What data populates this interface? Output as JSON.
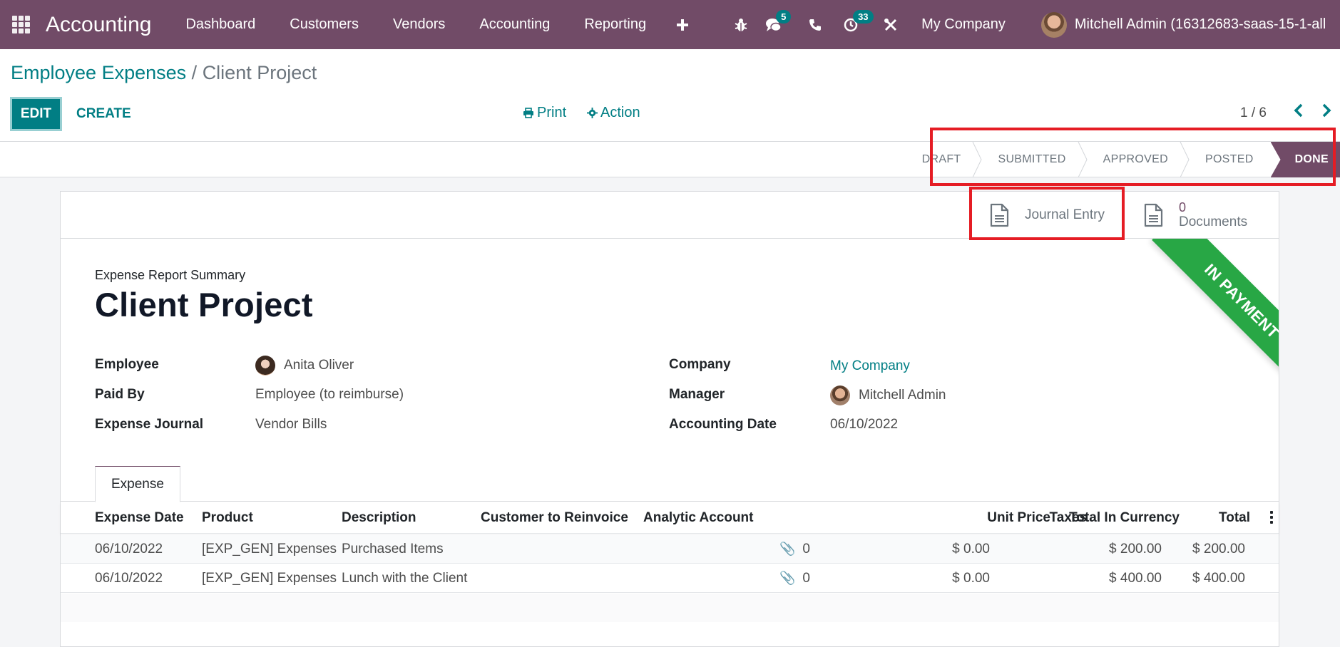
{
  "navbar": {
    "app_name": "Accounting",
    "menu": [
      "Dashboard",
      "Customers",
      "Vendors",
      "Accounting",
      "Reporting"
    ],
    "icons": {
      "apps": "apps-grid-icon",
      "plus": "plus-icon",
      "debug": "bug-icon",
      "messages": "chat-icon",
      "phone": "phone-icon",
      "activities": "clock-icon",
      "tools": "tools-icon"
    },
    "messages_badge": "5",
    "activities_badge": "33",
    "company": "My Company",
    "user": "Mitchell Admin (16312683-saas-15-1-all"
  },
  "control": {
    "breadcrumb_parent": "Employee Expenses",
    "breadcrumb_sep": "/",
    "breadcrumb_current": "Client Project",
    "edit_label": "EDIT",
    "create_label": "CREATE",
    "print_label": "Print",
    "action_label": "Action",
    "pager": "1 / 6",
    "pager_prev": "‹",
    "pager_next": "›"
  },
  "status": {
    "steps": [
      "DRAFT",
      "SUBMITTED",
      "APPROVED",
      "POSTED",
      "DONE"
    ],
    "active": "DONE"
  },
  "smart_buttons": {
    "journal_entry": "Journal Entry",
    "documents_count": "0",
    "documents_label": "Documents"
  },
  "ribbon": "IN PAYMENT",
  "form": {
    "subtitle": "Expense Report Summary",
    "title": "Client Project",
    "left_fields": [
      {
        "label": "Employee",
        "value": "Anita Oliver"
      },
      {
        "label": "Paid By",
        "value": "Employee (to reimburse)"
      },
      {
        "label": "Expense Journal",
        "value": "Vendor Bills"
      }
    ],
    "right_fields": [
      {
        "label": "Company",
        "value": "My Company"
      },
      {
        "label": "Manager",
        "value": "Mitchell Admin"
      },
      {
        "label": "Accounting Date",
        "value": "06/10/2022"
      }
    ]
  },
  "tabs": [
    "Expense"
  ],
  "table": {
    "columns": [
      "Expense Date",
      "Product",
      "Description",
      "Customer to Reinvoice",
      "Analytic Account",
      "Unit Price",
      "Taxes",
      "Total In Currency",
      "Total"
    ],
    "rows": [
      {
        "date": "06/10/2022",
        "product": "[EXP_GEN] Expenses",
        "description": "Purchased Items",
        "customer": "",
        "analytic": "",
        "attachments": "0",
        "unit_price": "$ 0.00",
        "taxes": "",
        "total_currency": "$ 200.00",
        "total": "$ 200.00"
      },
      {
        "date": "06/10/2022",
        "product": "[EXP_GEN] Expenses",
        "description": "Lunch with the Client",
        "customer": "",
        "analytic": "",
        "attachments": "0",
        "unit_price": "$ 0.00",
        "taxes": "",
        "total_currency": "$ 400.00",
        "total": "$ 400.00"
      }
    ]
  },
  "colors": {
    "brand": "#714b67",
    "accent": "#017e84",
    "ribbon": "#28a745",
    "highlight": "#e51c24"
  }
}
